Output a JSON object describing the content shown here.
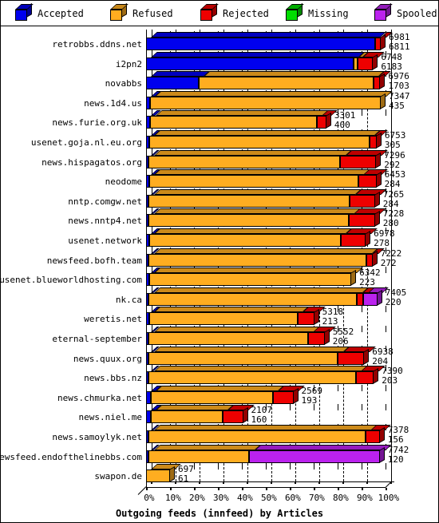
{
  "legend": {
    "items": [
      {
        "label": "Accepted",
        "color": "#0000ee",
        "icon": "cube-icon"
      },
      {
        "label": "Refused",
        "color": "#ffad20",
        "icon": "cube-icon"
      },
      {
        "label": "Rejected",
        "color": "#ee0000",
        "icon": "cube-icon"
      },
      {
        "label": "Missing",
        "color": "#00dd00",
        "icon": "cube-icon"
      },
      {
        "label": "Spooled",
        "color": "#bb22ee",
        "icon": "cube-icon"
      }
    ]
  },
  "chart_data": {
    "type": "bar",
    "orientation": "horizontal",
    "stacked": true,
    "title": "Outgoing feeds (innfeed) by Articles",
    "xlabel": "Outgoing feeds (innfeed) by Articles",
    "ylabel": "",
    "xlim": [
      0,
      100
    ],
    "xunit": "%",
    "grid": true,
    "legend_position": "top",
    "xticks": [
      "0%",
      "10%",
      "20%",
      "30%",
      "40%",
      "50%",
      "60%",
      "70%",
      "80%",
      "90%",
      "100%"
    ],
    "xtickvalues": [
      0,
      10,
      20,
      30,
      40,
      50,
      60,
      70,
      80,
      90,
      100
    ],
    "series": [
      {
        "name": "Accepted",
        "color": "#0000ee"
      },
      {
        "name": "Refused",
        "color": "#ffad20"
      },
      {
        "name": "Rejected",
        "color": "#ee0000"
      },
      {
        "name": "Missing",
        "color": "#00dd00"
      },
      {
        "name": "Spooled",
        "color": "#bb22ee"
      }
    ],
    "categories": [
      "retrobbs.ddns.net",
      "i2pn2",
      "novabbs",
      "news.1d4.us",
      "news.furie.org.uk",
      "usenet.goja.nl.eu.org",
      "news.hispagatos.org",
      "neodome",
      "nntp.comgw.net",
      "news.nntp4.net",
      "usenet.network",
      "newsfeed.bofh.team",
      "usenet.blueworldhosting.com",
      "nk.ca",
      "weretis.net",
      "eternal-september",
      "news.quux.org",
      "news.bbs.nz",
      "news.chmurka.net",
      "news.niel.me",
      "news.samoylyk.net",
      "newsfeed.endofthelinebbs.com",
      "swapon.de"
    ],
    "rows": [
      {
        "label": "retrobbs.ddns.net",
        "total": 6981,
        "second": 6811,
        "segments": [
          {
            "s": "Accepted",
            "pct": 95.8
          },
          {
            "s": "Rejected",
            "pct": 2.2
          }
        ]
      },
      {
        "label": "i2pn2",
        "total": 6748,
        "second": 6183,
        "segments": [
          {
            "s": "Accepted",
            "pct": 86.5
          },
          {
            "s": "Refused",
            "pct": 1.7
          },
          {
            "s": "Rejected",
            "pct": 6.6
          }
        ]
      },
      {
        "label": "novabbs",
        "total": 6976,
        "second": 1703,
        "segments": [
          {
            "s": "Accepted",
            "pct": 22.0
          },
          {
            "s": "Refused",
            "pct": 73.0
          },
          {
            "s": "Rejected",
            "pct": 2.8
          }
        ]
      },
      {
        "label": "news.1d4.us",
        "total": 7347,
        "second": 435,
        "segments": [
          {
            "s": "Accepted",
            "pct": 1.5
          },
          {
            "s": "Refused",
            "pct": 96.5
          }
        ]
      },
      {
        "label": "news.furie.org.uk",
        "total": 3301,
        "second": 400,
        "segments": [
          {
            "s": "Accepted",
            "pct": 1.8
          },
          {
            "s": "Refused",
            "pct": 69.5
          },
          {
            "s": "Rejected",
            "pct": 4.0
          }
        ]
      },
      {
        "label": "usenet.goja.nl.eu.org",
        "total": 6753,
        "second": 305,
        "segments": [
          {
            "s": "Accepted",
            "pct": 1.3
          },
          {
            "s": "Refused",
            "pct": 92.0
          },
          {
            "s": "Rejected",
            "pct": 3.0
          }
        ]
      },
      {
        "label": "news.hispagatos.org",
        "total": 7296,
        "second": 292,
        "segments": [
          {
            "s": "Accepted",
            "pct": 1.1
          },
          {
            "s": "Refused",
            "pct": 80.0
          },
          {
            "s": "Rejected",
            "pct": 15.0
          }
        ]
      },
      {
        "label": "neodome",
        "total": 6453,
        "second": 284,
        "segments": [
          {
            "s": "Accepted",
            "pct": 1.2
          },
          {
            "s": "Refused",
            "pct": 87.5
          },
          {
            "s": "Rejected",
            "pct": 7.5
          }
        ]
      },
      {
        "label": "nntp.comgw.net",
        "total": 7265,
        "second": 284,
        "segments": [
          {
            "s": "Accepted",
            "pct": 1.1
          },
          {
            "s": "Refused",
            "pct": 84.0
          },
          {
            "s": "Rejected",
            "pct": 10.5
          }
        ]
      },
      {
        "label": "news.nntp4.net",
        "total": 7228,
        "second": 280,
        "segments": [
          {
            "s": "Accepted",
            "pct": 1.1
          },
          {
            "s": "Refused",
            "pct": 83.5
          },
          {
            "s": "Rejected",
            "pct": 11.0
          }
        ]
      },
      {
        "label": "usenet.network",
        "total": 6978,
        "second": 278,
        "segments": [
          {
            "s": "Accepted",
            "pct": 1.2
          },
          {
            "s": "Refused",
            "pct": 80.0
          },
          {
            "s": "Rejected",
            "pct": 10.5
          }
        ]
      },
      {
        "label": "newsfeed.bofh.team",
        "total": 7222,
        "second": 272,
        "segments": [
          {
            "s": "Accepted",
            "pct": 1.1
          },
          {
            "s": "Refused",
            "pct": 91.0
          },
          {
            "s": "Rejected",
            "pct": 2.5
          }
        ]
      },
      {
        "label": "usenet.blueworldhosting.com",
        "total": 6342,
        "second": 223,
        "segments": [
          {
            "s": "Accepted",
            "pct": 1.2
          },
          {
            "s": "Refused",
            "pct": 84.5
          }
        ]
      },
      {
        "label": "nk.ca",
        "total": 7405,
        "second": 220,
        "segments": [
          {
            "s": "Accepted",
            "pct": 1.1
          },
          {
            "s": "Refused",
            "pct": 87.0
          },
          {
            "s": "Rejected",
            "pct": 2.5
          },
          {
            "s": "Spooled",
            "pct": 6.0
          }
        ]
      },
      {
        "label": "weretis.net",
        "total": 5318,
        "second": 213,
        "segments": [
          {
            "s": "Accepted",
            "pct": 1.2
          },
          {
            "s": "Refused",
            "pct": 62.0
          },
          {
            "s": "Rejected",
            "pct": 7.0
          }
        ]
      },
      {
        "label": "eternal-september",
        "total": 5552,
        "second": 206,
        "segments": [
          {
            "s": "Accepted",
            "pct": 1.1
          },
          {
            "s": "Refused",
            "pct": 66.5
          },
          {
            "s": "Rejected",
            "pct": 7.0
          }
        ]
      },
      {
        "label": "news.quux.org",
        "total": 6938,
        "second": 204,
        "segments": [
          {
            "s": "Accepted",
            "pct": 1.1
          },
          {
            "s": "Refused",
            "pct": 79.0
          },
          {
            "s": "Rejected",
            "pct": 11.0
          }
        ]
      },
      {
        "label": "news.bbs.nz",
        "total": 7390,
        "second": 203,
        "segments": [
          {
            "s": "Accepted",
            "pct": 1.1
          },
          {
            "s": "Refused",
            "pct": 86.5
          },
          {
            "s": "Rejected",
            "pct": 7.5
          }
        ]
      },
      {
        "label": "news.chmurka.net",
        "total": 2569,
        "second": 193,
        "segments": [
          {
            "s": "Accepted",
            "pct": 2.0
          },
          {
            "s": "Refused",
            "pct": 51.0
          },
          {
            "s": "Rejected",
            "pct": 8.5
          }
        ]
      },
      {
        "label": "news.niel.me",
        "total": 2107,
        "second": 160,
        "segments": [
          {
            "s": "Accepted",
            "pct": 2.0
          },
          {
            "s": "Refused",
            "pct": 30.0
          },
          {
            "s": "Rejected",
            "pct": 8.5
          }
        ]
      },
      {
        "label": "news.samoylyk.net",
        "total": 7378,
        "second": 156,
        "segments": [
          {
            "s": "Accepted",
            "pct": 1.1
          },
          {
            "s": "Refused",
            "pct": 90.5
          },
          {
            "s": "Rejected",
            "pct": 6.0
          }
        ]
      },
      {
        "label": "newsfeed.endofthelinebbs.com",
        "total": 7742,
        "second": 120,
        "segments": [
          {
            "s": "Accepted",
            "pct": 1.1
          },
          {
            "s": "Refused",
            "pct": 42.0
          },
          {
            "s": "Spooled",
            "pct": 54.5
          }
        ]
      },
      {
        "label": "swapon.de",
        "total": 697,
        "second": 61,
        "segments": [
          {
            "s": "Refused",
            "pct": 10.0
          }
        ]
      }
    ]
  }
}
